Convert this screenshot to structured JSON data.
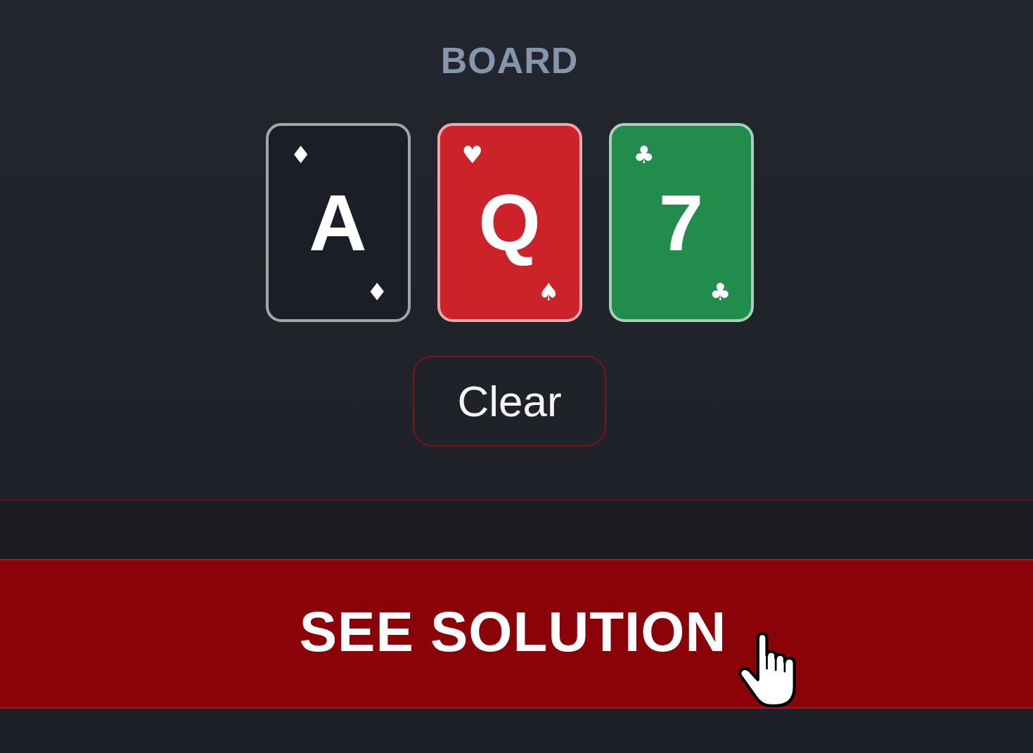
{
  "board": {
    "label": "BOARD",
    "cards": [
      {
        "rank": "A",
        "suit_top": "♦",
        "suit_bottom": "♦",
        "color": "#1b1e27"
      },
      {
        "rank": "Q",
        "suit_top": "♥",
        "suit_bottom": "♠",
        "color": "#cc2229"
      },
      {
        "rank": "7",
        "suit_top": "♣",
        "suit_bottom": "♣",
        "color": "#218c4b"
      }
    ],
    "clear_button": "Clear"
  },
  "solution_button": "SEE SOLUTION"
}
